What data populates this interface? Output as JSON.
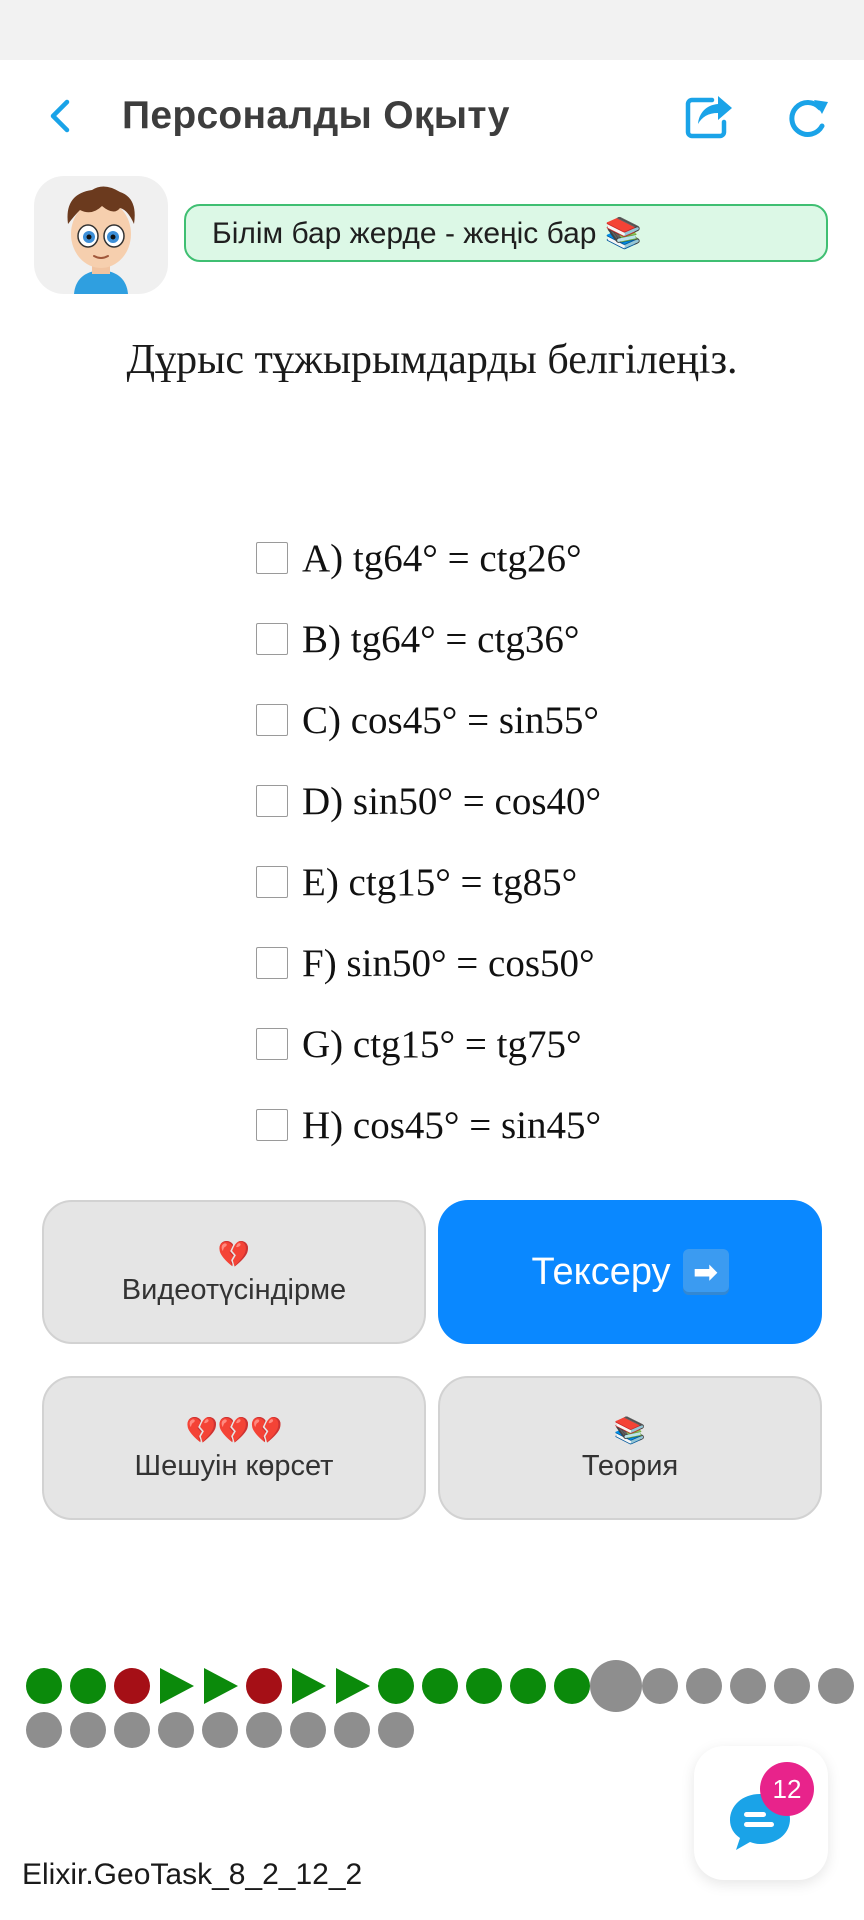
{
  "header": {
    "title": "Персоналды Оқыту",
    "back_icon": "chevron-left-icon",
    "share_icon": "share-icon",
    "refresh_icon": "refresh-icon",
    "accent_color": "#1aa3e8"
  },
  "motto": "Білім бар жерде - жеңіс бар 📚",
  "question": "Дұрыс тұжырымдарды белгілеңіз.",
  "options": [
    {
      "label": "A) tg64° = ctg26°",
      "checked": false
    },
    {
      "label": "B) tg64° = ctg36°",
      "checked": false
    },
    {
      "label": "C) cos45° = sin55°",
      "checked": false
    },
    {
      "label": "D) sin50° = cos40°",
      "checked": false
    },
    {
      "label": "E) ctg15° = tg85°",
      "checked": false
    },
    {
      "label": "F) sin50° = cos50°",
      "checked": false
    },
    {
      "label": "G) ctg15° = tg75°",
      "checked": false
    },
    {
      "label": "H) cos45° = sin45°",
      "checked": false
    }
  ],
  "buttons": {
    "video": {
      "emoji": "💔",
      "label": "Видеотүсіндірме"
    },
    "check": {
      "label": "Тексеру",
      "arrow": "➡"
    },
    "solution": {
      "emoji": "💔💔💔",
      "label": "Шешуін көрсет"
    },
    "theory": {
      "emoji": "📚",
      "label": "Теория"
    }
  },
  "progress": {
    "colors": {
      "correct": "#0b8a0b",
      "wrong": "#a50f16",
      "skipped": "#0b8a0b",
      "pending": "#8e8e8e",
      "current": "#8e8e8e"
    },
    "items": [
      "correct",
      "correct",
      "wrong",
      "skipped",
      "skipped",
      "wrong",
      "skipped",
      "skipped",
      "correct",
      "correct",
      "correct",
      "correct",
      "correct",
      "current",
      "pending",
      "pending",
      "pending",
      "pending",
      "pending",
      "pending",
      "pending",
      "pending",
      "pending",
      "pending",
      "pending",
      "pending",
      "pending",
      "pending"
    ]
  },
  "chat": {
    "badge_count": "12",
    "icon": "chat-bubble-icon"
  },
  "task_id": "Elixir.GeoTask_8_2_12_2"
}
